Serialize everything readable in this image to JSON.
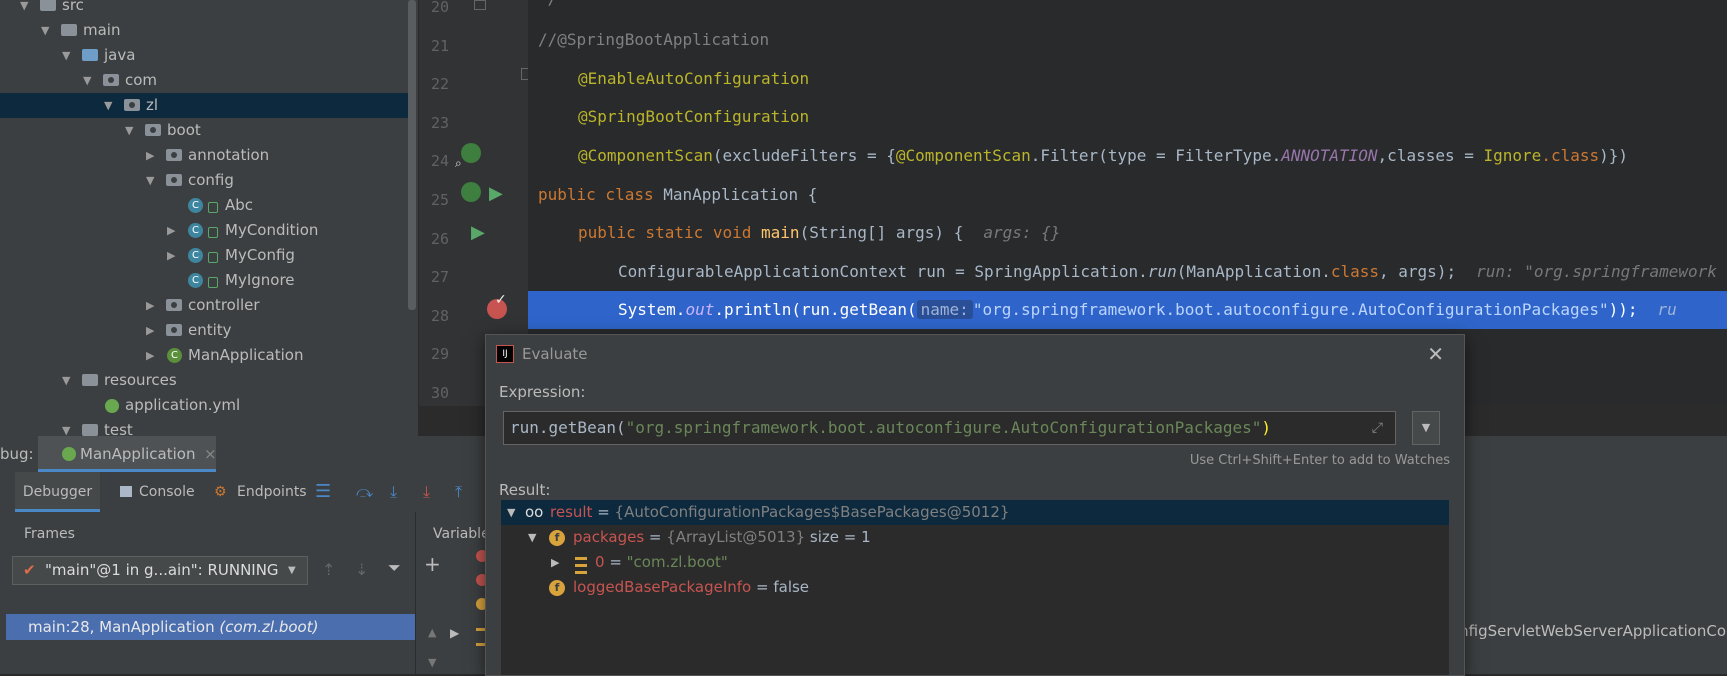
{
  "project_tree": {
    "items": [
      {
        "label": "src",
        "depth": 0,
        "arrow": "▼",
        "icon": "folder"
      },
      {
        "label": "main",
        "depth": 1,
        "arrow": "▼",
        "icon": "folder"
      },
      {
        "label": "java",
        "depth": 2,
        "arrow": "▼",
        "icon": "folder-blue"
      },
      {
        "label": "com",
        "depth": 3,
        "arrow": "▼",
        "icon": "package"
      },
      {
        "label": "zl",
        "depth": 4,
        "arrow": "▼",
        "icon": "package",
        "selected": true
      },
      {
        "label": "boot",
        "depth": 5,
        "arrow": "▼",
        "icon": "package"
      },
      {
        "label": "annotation",
        "depth": 6,
        "arrow": "▶",
        "icon": "package"
      },
      {
        "label": "config",
        "depth": 6,
        "arrow": "▼",
        "icon": "package"
      },
      {
        "label": "Abc",
        "depth": 7,
        "arrow": "",
        "icon": "class"
      },
      {
        "label": "MyCondition",
        "depth": 7,
        "arrow": "▶",
        "icon": "class"
      },
      {
        "label": "MyConfig",
        "depth": 7,
        "arrow": "▶",
        "icon": "class"
      },
      {
        "label": "MyIgnore",
        "depth": 7,
        "arrow": "",
        "icon": "class"
      },
      {
        "label": "controller",
        "depth": 6,
        "arrow": "▶",
        "icon": "package"
      },
      {
        "label": "entity",
        "depth": 6,
        "arrow": "▶",
        "icon": "package"
      },
      {
        "label": "ManApplication",
        "depth": 6,
        "arrow": "▶",
        "icon": "spring-class"
      },
      {
        "label": "resources",
        "depth": 2,
        "arrow": "▼",
        "icon": "folder"
      },
      {
        "label": "application.yml",
        "depth": 3,
        "arrow": "",
        "icon": "yml"
      },
      {
        "label": "test",
        "depth": 2,
        "arrow": "▼",
        "icon": "folder"
      }
    ]
  },
  "editor": {
    "line_numbers": [
      "20",
      "21",
      "22",
      "23",
      "24",
      "25",
      "26",
      "27",
      "28",
      "29",
      "30"
    ],
    "lines": {
      "l20": "*/",
      "l21": "//@SpringBootApplication",
      "l22": "@EnableAutoConfiguration",
      "l23": "@SpringBootConfiguration",
      "l24a": "@ComponentScan",
      "l24b": "(excludeFilters = {",
      "l24c": "@ComponentScan",
      "l24d": ".Filter",
      "l24e": "(type = FilterType.",
      "l24f": "ANNOTATION",
      "l24g": ",classes = ",
      "l24h": "Ignore",
      "l24i": ".class",
      "l24j": ")})",
      "l25a": "public class ",
      "l25b": "ManApplication {",
      "l26a": "public static void ",
      "l26b": "main",
      "l26c": "(String[] args) {",
      "l26d": "args: {}",
      "l27a": "ConfigurableApplicationContext run = SpringApplication.",
      "l27b": "run",
      "l27c": "(ManApplication.",
      "l27d": "class",
      "l27e": ", args);",
      "l27f": "run: \"org.springframework",
      "l28a": "System.",
      "l28b": "out",
      "l28c": ".println(run.getBean(",
      "l28d": "name:",
      "l28e": "\"org.springframework.boot.autoconfigure.AutoConfigurationPackages\"",
      "l28f": "));",
      "l28g": "ru"
    }
  },
  "debug": {
    "label": "bug:",
    "session_tab": "ManApplication",
    "tabs": [
      "Debugger",
      "Console",
      "Endpoints"
    ],
    "frames_header": "Frames",
    "variables_header": "Variable",
    "thread": "\"main\"@1 in g...ain\": RUNNING",
    "frame": "main:28, ManApplication",
    "frame_pkg": "(com.zl.boot)",
    "partial_var": "onfigServletWebServerApplicationCo"
  },
  "evaluate": {
    "title": "Evaluate",
    "expression_label": "Expression:",
    "expr_a": "run.getBean(",
    "expr_b": "\"org.springframework.boot.autoconfigure.AutoConfigurationPackages\"",
    "expr_c": ")",
    "hint": "Use Ctrl+Shift+Enter to add to Watches",
    "result_label": "Result:",
    "result": {
      "name": "result",
      "value": "{AutoConfigurationPackages$BasePackages@5012}",
      "packages_name": "packages",
      "packages_value": "{ArrayList@5013}",
      "packages_size": "size = 1",
      "item_name": "0",
      "item_value": "\"com.zl.boot\"",
      "logged_name": "loggedBasePackageInfo",
      "logged_value": "false"
    }
  },
  "colors": {
    "accent": "#4b6eaf",
    "highlight_line": "#2f65ca",
    "keyword": "#cc7832",
    "annotation": "#bbb529",
    "string": "#6a8759",
    "field_name": "#c75450"
  }
}
